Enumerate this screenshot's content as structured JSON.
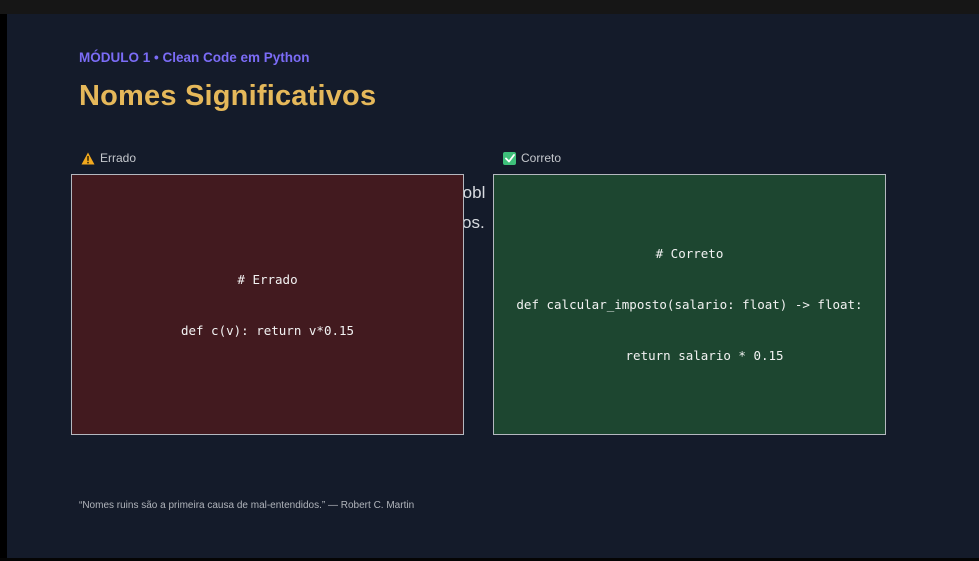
{
  "colors": {
    "slide_background": "#141b2a",
    "module_label": "#7b6cf6",
    "title": "#e5b85a",
    "label_text": "#c4c7cc",
    "body_text": "#d8dbe0",
    "wrong_panel": "#421a1f",
    "right_panel": "#1d4630",
    "code_text": "#f2f2f2",
    "warning_icon": "#f2a91e",
    "check_icon": "#3ec07a",
    "quote_text": "#b0b4bb"
  },
  "header": {
    "module_label": "MÓDULO 1 • Clean Code em Python",
    "title": "Nomes Significativos"
  },
  "columns": {
    "wrong": {
      "icon": "warning-icon",
      "label": "Errado"
    },
    "right": {
      "icon": "check-icon",
      "label": "Correto"
    }
  },
  "background_text": {
    "line1": "robl",
    "line2": "os."
  },
  "code": {
    "wrong": {
      "line1": "# Errado",
      "line2": "def c(v): return v*0.15"
    },
    "right": {
      "line1": "# Correto",
      "line2": "def calcular_imposto(salario: float) -> float:",
      "line3": "    return salario * 0.15"
    }
  },
  "footer": {
    "quote": "“Nomes ruins são a primeira causa de mal-entendidos.” — Robert C. Martin"
  }
}
